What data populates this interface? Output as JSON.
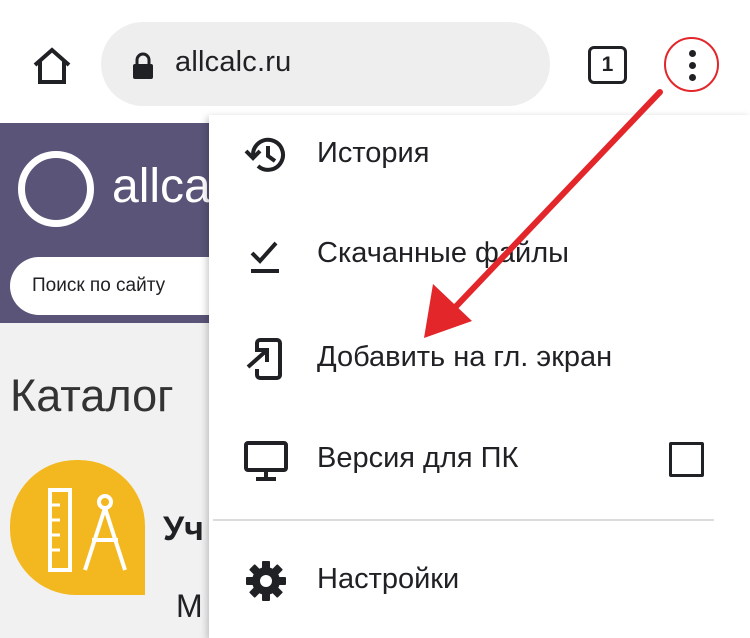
{
  "browser": {
    "url": "allcalc.ru",
    "tab_count": "1"
  },
  "site": {
    "logo_text": "allca",
    "search_placeholder": "Поиск по сайту",
    "catalog_title": "Каталог",
    "catalog_item_title": "Уч",
    "catalog_item_sub": "М"
  },
  "menu": {
    "items": [
      {
        "label": "История",
        "icon": "history-icon"
      },
      {
        "label": "Скачанные файлы",
        "icon": "downloads-icon"
      },
      {
        "label": "Добавить на гл. экран",
        "icon": "add-to-home-screen-icon"
      },
      {
        "label": "Версия для ПК",
        "icon": "desktop-icon",
        "checked": false
      },
      {
        "label": "Настройки",
        "icon": "settings-icon"
      }
    ]
  },
  "colors": {
    "site_header": "#5a5478",
    "catalog_icon": "#f3b820",
    "annotation_red": "#e3262a"
  }
}
